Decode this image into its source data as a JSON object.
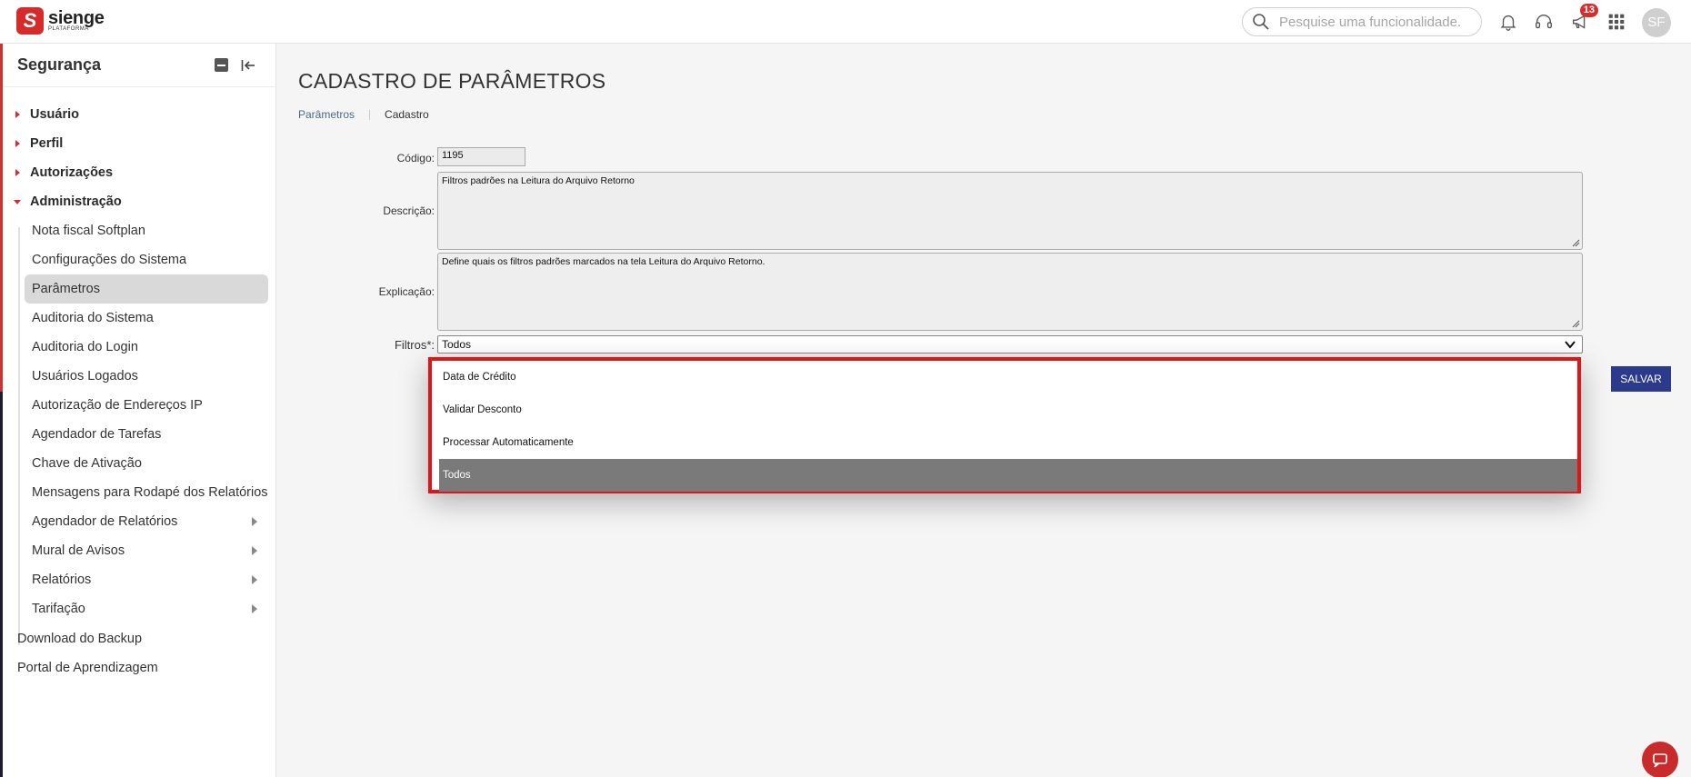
{
  "app": {
    "logo_name": "sienge",
    "logo_sub": "PLATAFORMA",
    "logo_letter": "S"
  },
  "header": {
    "search_placeholder": "Pesquise uma funcionalidade.",
    "notifications_badge": "13",
    "avatar_initials": "SF"
  },
  "sidebar": {
    "title": "Segurança",
    "top_items": [
      {
        "label": "Usuário"
      },
      {
        "label": "Perfil"
      },
      {
        "label": "Autorizações"
      },
      {
        "label": "Administração"
      }
    ],
    "sub_items": [
      {
        "label": "Nota fiscal Softplan"
      },
      {
        "label": "Configurações do Sistema"
      },
      {
        "label": "Parâmetros"
      },
      {
        "label": "Auditoria do Sistema"
      },
      {
        "label": "Auditoria do Login"
      },
      {
        "label": "Usuários Logados"
      },
      {
        "label": "Autorização de Endereços IP"
      },
      {
        "label": "Agendador de Tarefas"
      },
      {
        "label": "Chave de Ativação"
      },
      {
        "label": "Mensagens para Rodapé dos Relatórios"
      },
      {
        "label": "Agendador de Relatórios"
      },
      {
        "label": "Mural de Avisos"
      },
      {
        "label": "Relatórios"
      },
      {
        "label": "Tarifação"
      }
    ],
    "bottom_items": [
      {
        "label": "Download do Backup"
      },
      {
        "label": "Portal de Aprendizagem"
      }
    ]
  },
  "main": {
    "title": "CADASTRO DE PARÂMETROS",
    "breadcrumb": {
      "parent": "Parâmetros",
      "current": "Cadastro"
    },
    "form": {
      "codigo_label": "Código:",
      "codigo_value": "1195",
      "descricao_label": "Descrição:",
      "descricao_value": "Filtros padrões na Leitura do Arquivo Retorno",
      "explicacao_label": "Explicação:",
      "explicacao_value": "Define quais os filtros padrões marcados na tela Leitura do Arquivo Retorno.",
      "filtros_label": "Filtros*:",
      "filtros_value": "Todos",
      "filtros_options": [
        "Data de Crédito",
        "Validar Desconto",
        "Processar Automaticamente",
        "Todos"
      ]
    },
    "save_label": "SALVAR"
  },
  "colors": {
    "brand_red": "#d52b2b",
    "save_blue": "#2c3a8c",
    "highlight_red": "#e01515",
    "selected_gray": "#7a7a7a"
  }
}
